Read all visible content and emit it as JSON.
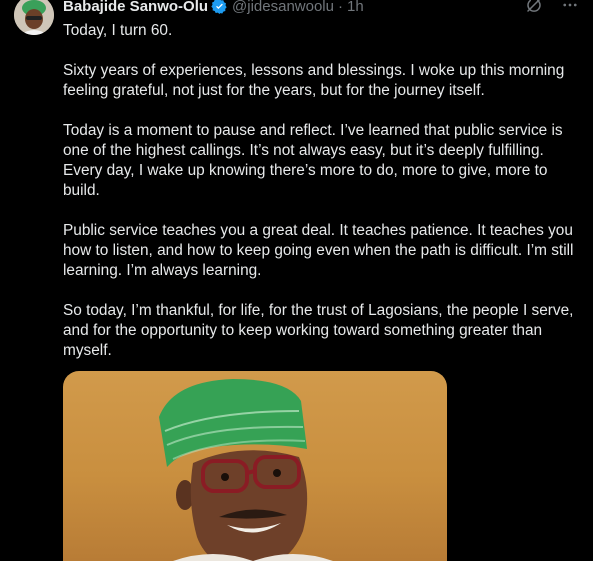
{
  "author": {
    "display_name": "Babajide Sanwo-Olu",
    "handle": "@jidesanwoolu",
    "separator": "·",
    "time": "1h"
  },
  "icons": {
    "verified": "verified-badge-icon",
    "grok": "grok-icon",
    "more": "more-icon",
    "verified_color": "#1d9bf0"
  },
  "tweet": {
    "paragraphs": [
      "Today, I turn 60.",
      "Sixty years of experiences, lessons and blessings. I woke up this morning feeling grateful, not just for the years, but for the journey itself.",
      "Today is a moment to pause and reflect. I’ve learned that public service is one of the highest callings. It’s not always easy, but it’s deeply fulfilling. Every day, I wake up knowing there’s more to do, more to give, more to build.",
      "Public service teaches you a great deal. It teaches patience. It teaches you how to listen, and how to keep going even when the path is difficult. I’m still learning. I’m always learning.",
      "So today, I’m thankful, for life, for the trust of Lagosians, the people I serve, and for the opportunity to keep working toward something greater than myself."
    ]
  }
}
